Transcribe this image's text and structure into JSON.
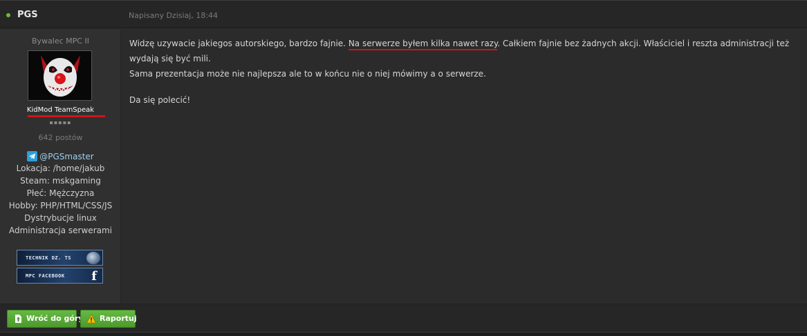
{
  "post": {
    "author": "PGS",
    "date": "Napisany Dzisiaj, 18:44"
  },
  "sidebar": {
    "rank": "Bywalec MPC II",
    "group": "KidMod TeamSpeak",
    "pips": "▪▪▪▪▪",
    "post_count": "642 postów",
    "telegram": "@PGSmaster",
    "fields": [
      "Lokacja: /home/jakub",
      "Steam: mskgaming",
      "Płeć: Mężczyzna",
      "Hobby: PHP/HTML/CSS/JS",
      "Dystrybucje linux",
      "Administracja serwerami"
    ],
    "banners": [
      "TECHNIK DZ. TS",
      "MPC FACEBOOK"
    ]
  },
  "content": {
    "line1_a": "Widzę uzywacie jakiegos autorskiego, bardzo fajnie.",
    "line1_highlight": "Na serwerze byłem kilka nawet razy",
    "line1_b": ". Całkiem fajnie bez żadnych akcji. Właściciel i reszta administracji też wydają się być mili.",
    "line2": "Sama prezentacja może nie najlepsza ale to w końcu nie o niej mówimy a o serwerze.",
    "line3": "Da się polecić!"
  },
  "footer": {
    "back_to_top": "Wróć do góry",
    "report": "Raportuj"
  },
  "colors": {
    "accent_green": "#5aa838",
    "highlight_red": "#d0141c",
    "online": "#6bbe2e"
  }
}
